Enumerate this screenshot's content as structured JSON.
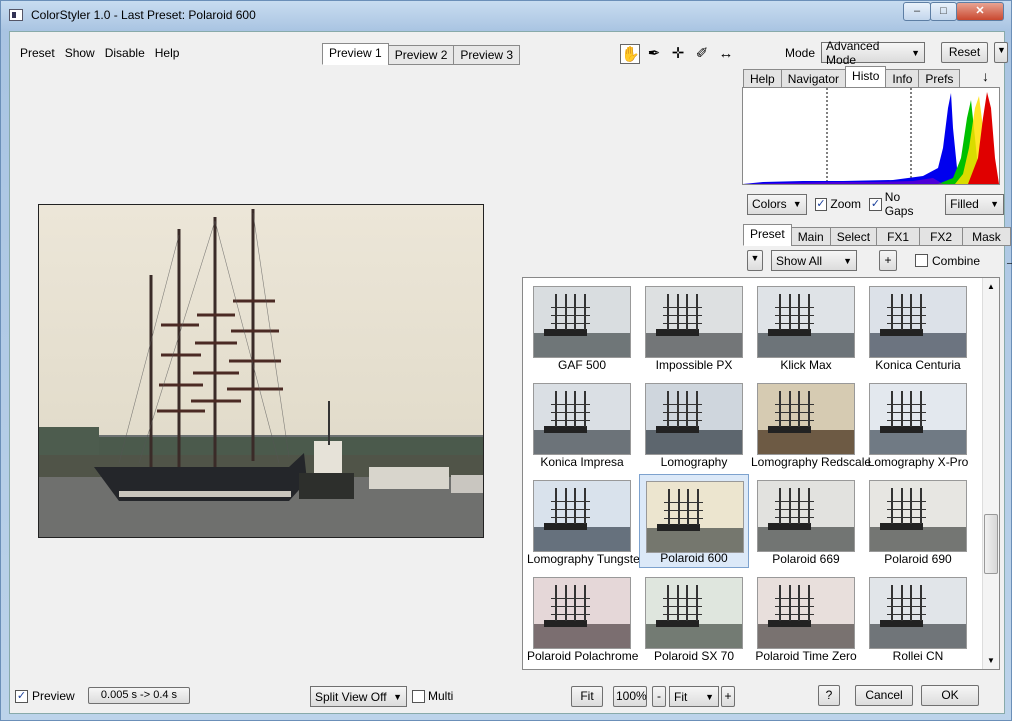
{
  "window": {
    "title": "ColorStyler 1.0 - Last Preset: Polaroid 600"
  },
  "menu": [
    "Preset",
    "Show",
    "Disable",
    "Help"
  ],
  "preview_tabs": [
    {
      "label": "Preview 1",
      "active": true
    },
    {
      "label": "Preview 2",
      "active": false
    },
    {
      "label": "Preview 3",
      "active": false
    }
  ],
  "tools": [
    "hand-icon",
    "eyedropper-icon",
    "crosshair-icon",
    "brush-icon",
    "split-arrows-icon"
  ],
  "mode": {
    "label": "Mode",
    "value": "Advanced Mode",
    "reset_label": "Reset"
  },
  "info_tabs": [
    {
      "label": "Help",
      "active": false
    },
    {
      "label": "Navigator",
      "active": false
    },
    {
      "label": "Histo",
      "active": true
    },
    {
      "label": "Info",
      "active": false
    },
    {
      "label": "Prefs",
      "active": false
    }
  ],
  "histo_controls": {
    "channel": "Colors",
    "zoom_label": "Zoom",
    "zoom_checked": true,
    "nogaps_label": "No Gaps",
    "nogaps_checked": true,
    "style": "Filled"
  },
  "preset_tabs": [
    {
      "label": "Preset",
      "active": true
    },
    {
      "label": "Main",
      "active": false
    },
    {
      "label": "Select",
      "active": false
    },
    {
      "label": "FX1",
      "active": false
    },
    {
      "label": "FX2",
      "active": false
    },
    {
      "label": "Mask",
      "active": false
    }
  ],
  "preset_filter": {
    "value": "Show All",
    "add_label": "+",
    "combine_label": "Combine",
    "combine_checked": false
  },
  "presets": [
    {
      "label": "GAF 500",
      "tint": "#d9dde0",
      "sea": "#6f7678",
      "selected": false
    },
    {
      "label": "Impossible PX",
      "tint": "#dde0e1",
      "sea": "#737678",
      "selected": false
    },
    {
      "label": "Klick Max",
      "tint": "#dfe3e7",
      "sea": "#6d7479",
      "selected": false
    },
    {
      "label": "Konica Centuria",
      "tint": "#dce1e8",
      "sea": "#6c7480",
      "selected": false
    },
    {
      "label": "Konica Impresa",
      "tint": "#dadfe4",
      "sea": "#6c7379",
      "selected": false
    },
    {
      "label": "Lomography",
      "tint": "#cfd6dd",
      "sea": "#5d666e",
      "selected": false
    },
    {
      "label": "Lomography Redscale",
      "tint": "#d6cbb2",
      "sea": "#6d5a44",
      "selected": false
    },
    {
      "label": "Lomography X-Pro",
      "tint": "#e3e8ee",
      "sea": "#707a84",
      "selected": false
    },
    {
      "label": "Lomography Tungsten",
      "tint": "#d9e2ec",
      "sea": "#66717d",
      "selected": false
    },
    {
      "label": "Polaroid 600",
      "tint": "#ece5cf",
      "sea": "#75776e",
      "selected": true
    },
    {
      "label": "Polaroid 669",
      "tint": "#e2e2df",
      "sea": "#727573",
      "selected": false
    },
    {
      "label": "Polaroid 690",
      "tint": "#e7e6e2",
      "sea": "#747673",
      "selected": false
    },
    {
      "label": "Polaroid Polachrome",
      "tint": "#e5d7d8",
      "sea": "#7b6e70",
      "selected": false
    },
    {
      "label": "Polaroid SX 70",
      "tint": "#dfe6de",
      "sea": "#737b73",
      "selected": false
    },
    {
      "label": "Polaroid Time Zero",
      "tint": "#e8dfdc",
      "sea": "#797270",
      "selected": false
    },
    {
      "label": "Rollei CN",
      "tint": "#e1e5e9",
      "sea": "#707579",
      "selected": false
    }
  ],
  "status": {
    "preview_label": "Preview",
    "preview_checked": true,
    "timing": "0.005 s -> 0.4 s",
    "split_view": "Split View Off",
    "multi_label": "Multi",
    "multi_checked": false,
    "fit_label": "Fit",
    "zoom_100": "100%",
    "zoom_minus": "-",
    "zoom_value": "Fit",
    "zoom_plus": "+",
    "help_label": "?",
    "cancel_label": "Cancel",
    "ok_label": "OK"
  }
}
